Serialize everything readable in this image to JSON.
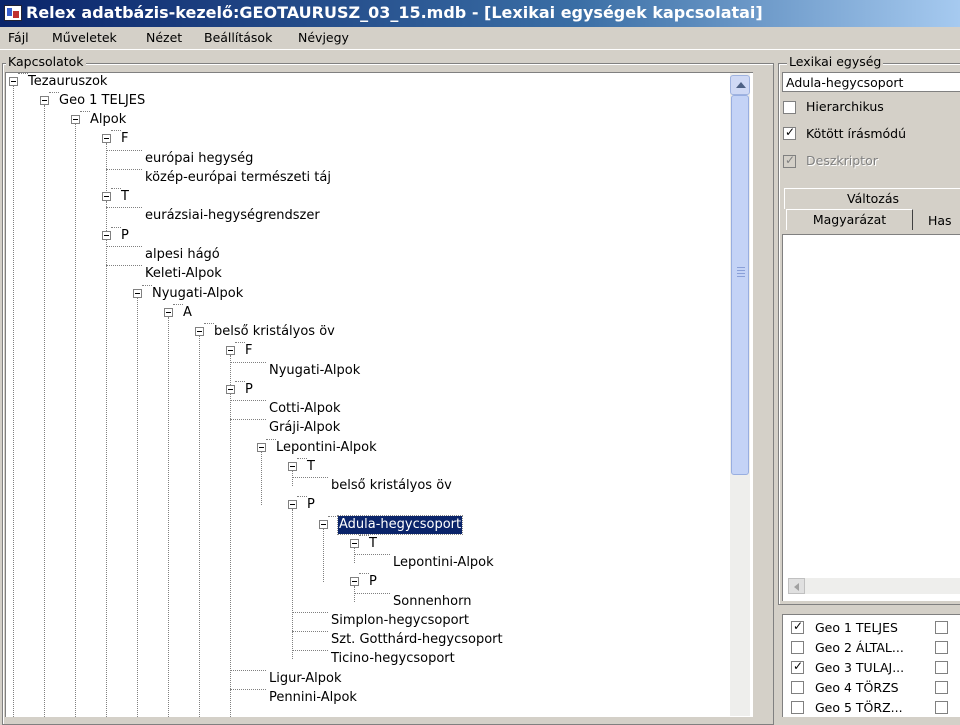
{
  "window": {
    "title": "Relex adatbázis-kezelő:GEOTAURUSZ_03_15.mdb - [Lexikai egységek kapcsolatai]"
  },
  "menu": [
    "Fájl",
    "Műveletek",
    "Nézet",
    "Beállítások",
    "Névjegy"
  ],
  "left_group": {
    "label": "Kapcsolatok"
  },
  "tree": [
    {
      "label": "Tezauruszok"
    },
    {
      "label": "Geo 1 TELJES"
    },
    {
      "label": "Alpok"
    },
    {
      "label": "F"
    },
    {
      "label": "európai hegység"
    },
    {
      "label": "közép-európai természeti táj"
    },
    {
      "label": "T"
    },
    {
      "label": "eurázsiai-hegységrendszer"
    },
    {
      "label": "P"
    },
    {
      "label": "alpesi hágó"
    },
    {
      "label": "Keleti-Alpok"
    },
    {
      "label": "Nyugati-Alpok"
    },
    {
      "label": "A"
    },
    {
      "label": "belső kristályos öv"
    },
    {
      "label": "F"
    },
    {
      "label": "Nyugati-Alpok"
    },
    {
      "label": "P"
    },
    {
      "label": "Cotti-Alpok"
    },
    {
      "label": "Gráji-Alpok"
    },
    {
      "label": "Lepontini-Alpok"
    },
    {
      "label": "T"
    },
    {
      "label": "belső kristályos öv"
    },
    {
      "label": "P"
    },
    {
      "label": "Adula-hegycsoport"
    },
    {
      "label": "T"
    },
    {
      "label": "Lepontini-Alpok"
    },
    {
      "label": "P"
    },
    {
      "label": "Sonnenhorn"
    },
    {
      "label": "Simplon-hegycsoport"
    },
    {
      "label": "Szt. Gotthárd-hegycsoport"
    },
    {
      "label": "Ticino-hegycsoport"
    },
    {
      "label": "Ligur-Alpok"
    },
    {
      "label": "Pennini-Alpok"
    }
  ],
  "right_panel": {
    "group_label": "Lexikai egység",
    "entry_value": "Adula-hegycsoport",
    "checkboxes": [
      {
        "label": "Hierarchikus",
        "checked": false,
        "disabled": false
      },
      {
        "label": "Kötött írásmódú",
        "checked": true,
        "disabled": false
      },
      {
        "label": "Deszkriptor",
        "checked": true,
        "disabled": true
      }
    ],
    "tab_header": "Változás",
    "tabs": [
      "Magyarázat",
      "Has"
    ]
  },
  "databases": [
    {
      "label": "Geo 1 TELJES",
      "checked": true
    },
    {
      "label": "Geo 2 ÁLTAL...",
      "checked": false
    },
    {
      "label": "Geo 3 TULAJ...",
      "checked": true
    },
    {
      "label": "Geo 4 TÖRZS",
      "checked": false
    },
    {
      "label": "Geo 5 TÖRZ...",
      "checked": false
    }
  ]
}
